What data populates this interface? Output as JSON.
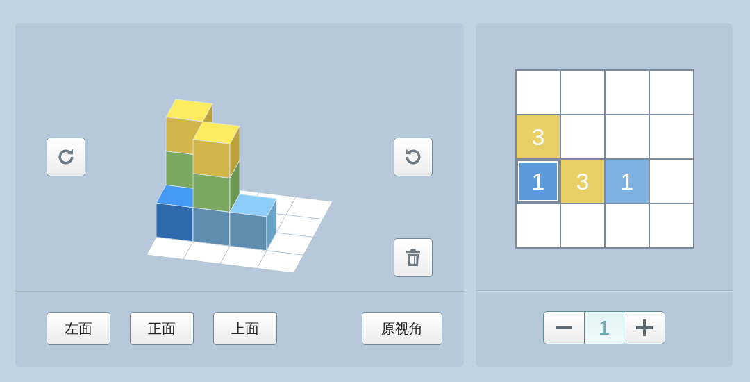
{
  "model_view": {
    "view_buttons": [
      "左面",
      "正面",
      "上面"
    ],
    "reset_button": "原视角"
  },
  "top_view": {
    "grid": [
      [
        {
          "color": "#ffffff",
          "selected": false
        },
        {
          "color": "#ffffff",
          "selected": false
        },
        {
          "color": "#ffffff",
          "selected": false
        },
        {
          "color": "#ffffff",
          "selected": false
        }
      ],
      [
        {
          "value": "3",
          "color": "#e8d066",
          "selected": false
        },
        {
          "color": "#ffffff",
          "selected": false
        },
        {
          "color": "#ffffff",
          "selected": false
        },
        {
          "color": "#ffffff",
          "selected": false
        }
      ],
      [
        {
          "value": "1",
          "color": "#5b9ad8",
          "selected": true
        },
        {
          "value": "3",
          "color": "#e8d066",
          "selected": false
        },
        {
          "value": "1",
          "color": "#7fb1e0",
          "selected": false
        },
        {
          "color": "#ffffff",
          "selected": false
        }
      ],
      [
        {
          "color": "#ffffff",
          "selected": false
        },
        {
          "color": "#ffffff",
          "selected": false
        },
        {
          "color": "#ffffff",
          "selected": false
        },
        {
          "color": "#ffffff",
          "selected": false
        }
      ]
    ]
  },
  "stepper": {
    "value": "1"
  }
}
